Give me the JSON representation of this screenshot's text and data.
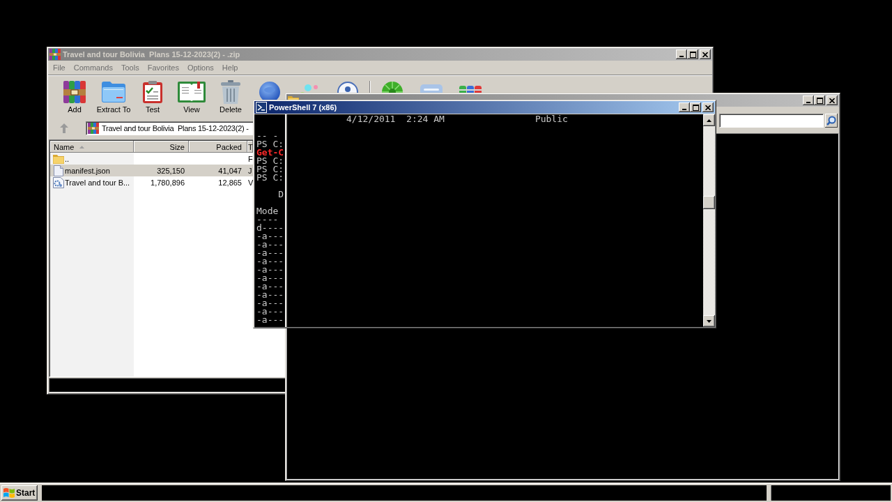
{
  "archive_window": {
    "title": "Travel and tour Bolivia  Plans 15-12-2023(2) - .zip",
    "active": false,
    "menu": [
      "File",
      "Commands",
      "Tools",
      "Favorites",
      "Options",
      "Help"
    ],
    "toolbar": [
      "Add",
      "Extract To",
      "Test",
      "View",
      "Delete"
    ],
    "path": "Travel and tour Bolivia  Plans 15-12-2023(2) -",
    "columns": [
      {
        "label": "Name",
        "sorted": true
      },
      {
        "label": "Size",
        "sorted": false
      },
      {
        "label": "Packed",
        "sorted": false
      },
      {
        "label": "T"
      }
    ],
    "files": [
      {
        "kind": "folder",
        "name": "..",
        "type": "F",
        "selected": false
      },
      {
        "kind": "document",
        "name": "manifest.json",
        "size": "325,150",
        "packed": "41,047",
        "type": "J",
        "selected": true
      },
      {
        "kind": "script",
        "name": "Travel and tour B...",
        "size": "1,780,896",
        "packed": "12,865",
        "type": "V",
        "selected": false
      }
    ]
  },
  "explorer_window": {
    "active": false
  },
  "console_window": {
    "title": "PowerShell 7 (x86)",
    "active": true,
    "entry": {
      "last_write_time": "4/12/2011  2:24 AM",
      "name": "Public"
    },
    "lines": [
      {
        "kind": "spacer"
      },
      {
        "kind": "spacer"
      },
      {
        "kind": "output",
        "text": "-- -"
      },
      {
        "kind": "output",
        "text": "PS C:"
      },
      {
        "kind": "error",
        "text": "Get-C"
      },
      {
        "kind": "output",
        "text": "PS C:"
      },
      {
        "kind": "output",
        "text": "PS C:"
      },
      {
        "kind": "output",
        "text": "PS C:"
      },
      {
        "kind": "spacer"
      },
      {
        "kind": "indented",
        "text": "D"
      },
      {
        "kind": "spacer"
      },
      {
        "kind": "output",
        "text": "Mode"
      },
      {
        "kind": "output",
        "text": "----"
      },
      {
        "kind": "output",
        "text": "d----"
      },
      {
        "kind": "output",
        "text": "-a---"
      },
      {
        "kind": "output",
        "text": "-a---"
      },
      {
        "kind": "output",
        "text": "-a---"
      },
      {
        "kind": "output",
        "text": "-a---"
      },
      {
        "kind": "output",
        "text": "-a---"
      },
      {
        "kind": "output",
        "text": "-a---"
      },
      {
        "kind": "output",
        "text": "-a---"
      },
      {
        "kind": "output",
        "text": "-a---"
      },
      {
        "kind": "output",
        "text": "-a---"
      },
      {
        "kind": "output",
        "text": "-a---"
      },
      {
        "kind": "output",
        "text": "-a---"
      }
    ]
  },
  "taskbar": {
    "start_label": "Start"
  }
}
